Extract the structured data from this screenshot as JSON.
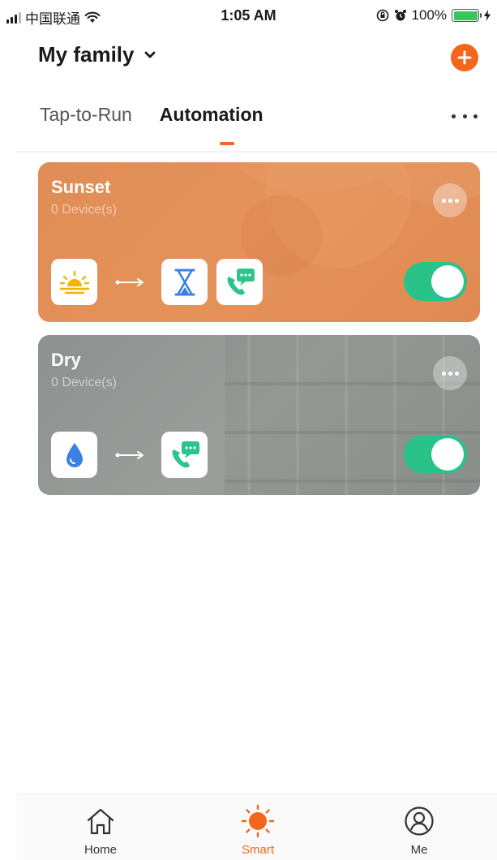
{
  "status_bar": {
    "carrier": "中国联通",
    "time": "1:05 AM",
    "battery": "100%"
  },
  "header": {
    "title": "My family"
  },
  "tabs": [
    {
      "label": "Tap-to-Run",
      "active": false
    },
    {
      "label": "Automation",
      "active": true
    }
  ],
  "automations": [
    {
      "name": "Sunset",
      "devices": "0 Device(s)",
      "enabled": true,
      "condition_icon": "sunset-icon",
      "action_icons": [
        "timer-icon",
        "phone-message-icon"
      ]
    },
    {
      "name": "Dry",
      "devices": "0 Device(s)",
      "enabled": true,
      "condition_icon": "water-drop-icon",
      "action_icons": [
        "phone-message-icon"
      ]
    }
  ],
  "bottom_nav": [
    {
      "label": "Home",
      "icon": "home-icon",
      "active": false
    },
    {
      "label": "Smart",
      "icon": "sun-icon",
      "active": true
    },
    {
      "label": "Me",
      "icon": "user-icon",
      "active": false
    }
  ],
  "colors": {
    "accent": "#f4661b",
    "toggle_on": "#29c389",
    "sunset_card": "#e08c55",
    "dry_card": "#8f9492"
  }
}
